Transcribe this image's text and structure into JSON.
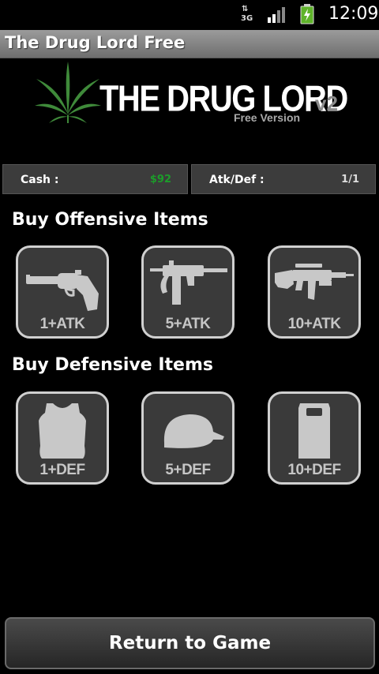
{
  "status_bar": {
    "network": "3G",
    "time": "12:09",
    "icons": [
      "data-arrows-icon",
      "signal-icon",
      "battery-charging-icon"
    ]
  },
  "app_title": "The Drug Lord Free",
  "logo": {
    "title": "THE DRUG LORD",
    "version": "v2",
    "subtitle": "Free Version",
    "icon": "cannabis-leaf-icon"
  },
  "stats": {
    "cash_label": "Cash :",
    "cash_value": "$92",
    "atkdef_label": "Atk/Def :",
    "atkdef_value": "1/1"
  },
  "offensive": {
    "heading": "Buy Offensive Items",
    "items": [
      {
        "caption": "1+ATK",
        "icon": "revolver-icon"
      },
      {
        "caption": "5+ATK",
        "icon": "submachine-gun-icon"
      },
      {
        "caption": "10+ATK",
        "icon": "assault-rifle-icon"
      }
    ]
  },
  "defensive": {
    "heading": "Buy Defensive Items",
    "items": [
      {
        "caption": "1+DEF",
        "icon": "vest-icon"
      },
      {
        "caption": "5+DEF",
        "icon": "helmet-icon"
      },
      {
        "caption": "10+DEF",
        "icon": "riot-shield-icon"
      }
    ]
  },
  "return_button": "Return to Game",
  "colors": {
    "cash_value": "#1c9c2a",
    "tile_bg": "#3a3a3a",
    "tile_border": "#d0d0d0",
    "logo_leaf": "#3f8a3a"
  }
}
